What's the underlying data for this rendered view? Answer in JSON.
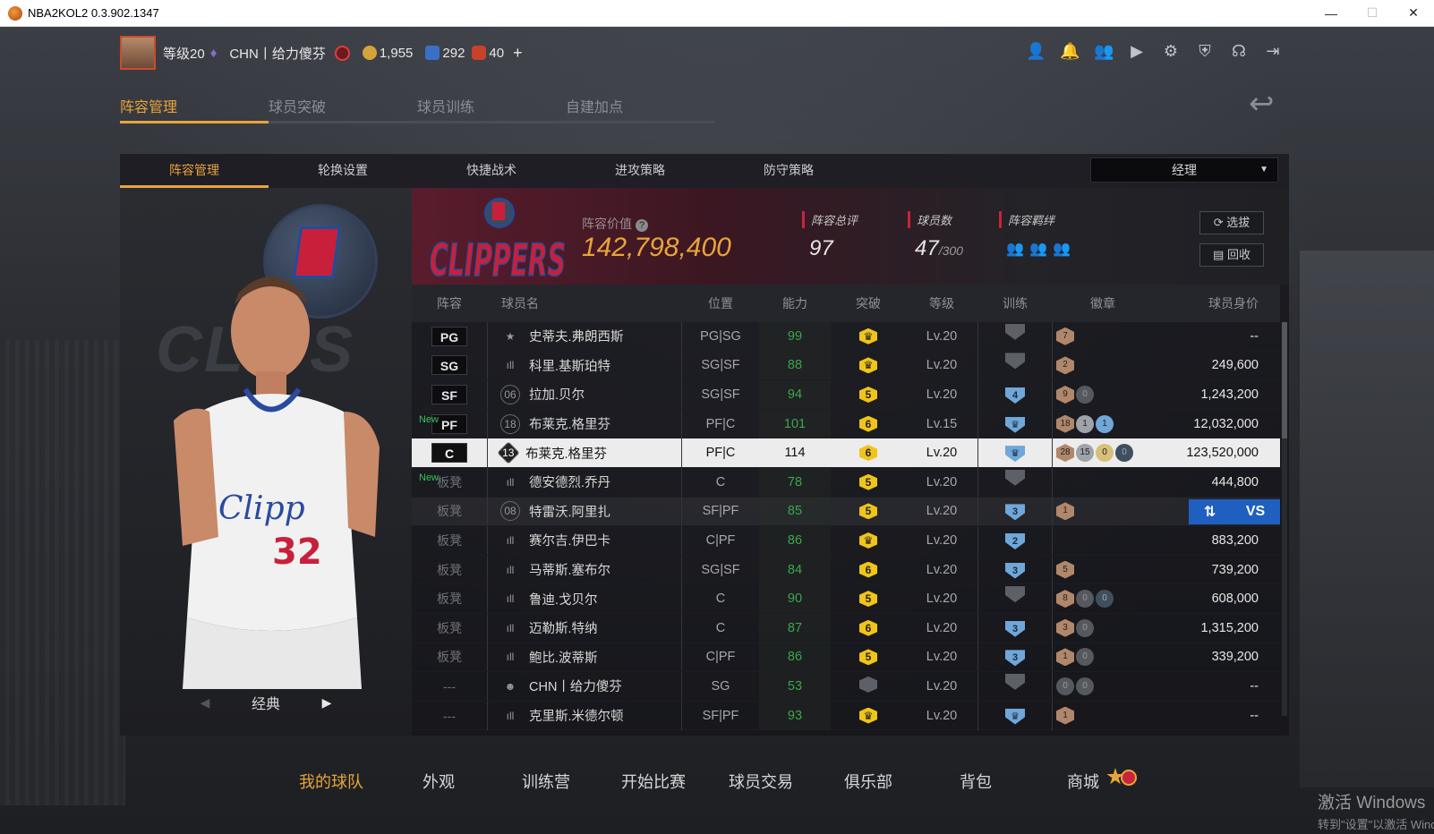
{
  "window": {
    "title": "NBA2KOL2 0.3.902.1347",
    "min": "—",
    "max": "☐",
    "close": "✕"
  },
  "status": {
    "level": "等级20",
    "player": "CHN丨给力傻芬",
    "gold": "1,955",
    "points": "292",
    "tickets": "40",
    "add": "+"
  },
  "toolbar_icons": [
    "user-icon",
    "bell-icon",
    "friends-icon",
    "video-icon",
    "gear-icon",
    "shield-gear-icon",
    "headset-icon",
    "logout-icon"
  ],
  "main_tabs": [
    "阵容管理",
    "球员突破",
    "球员训练",
    "自建加点"
  ],
  "sub_tabs": [
    "阵容管理",
    "轮换设置",
    "快捷战术",
    "进攻策略",
    "防守策略"
  ],
  "role_select": {
    "value": "经理"
  },
  "team": {
    "value_label": "阵容价值",
    "value": "142,798,400",
    "logo_text": "CLIPPERS"
  },
  "stats": {
    "rating_label": "阵容总评",
    "rating": "97",
    "count_label": "球员数",
    "count": "47",
    "count_max": "/300",
    "bond_label": "阵容羁绊"
  },
  "buttons": {
    "select": "选拔",
    "recycle": "回收"
  },
  "carousel": {
    "label": "经典"
  },
  "columns": [
    "阵容",
    "球员名",
    "位置",
    "能力",
    "突破",
    "等级",
    "训练",
    "徽章",
    "球员身价"
  ],
  "rows": [
    {
      "pos": "PG",
      "bench": false,
      "new": "",
      "icon": "★",
      "name": "史蒂夫.弗朗西斯",
      "p": "PG|SG",
      "ab": "99",
      "br": "♛",
      "lv": "Lv.20",
      "tr": "",
      "badges": [
        [
          "br",
          "7"
        ]
      ],
      "price": "--"
    },
    {
      "pos": "SG",
      "bench": false,
      "new": "",
      "icon": "ıll",
      "name": "科里.基斯珀特",
      "p": "SG|SF",
      "ab": "88",
      "br": "♛",
      "lv": "Lv.20",
      "tr": "",
      "badges": [
        [
          "br",
          "2"
        ]
      ],
      "price": "249,600"
    },
    {
      "pos": "SF",
      "bench": false,
      "new": "",
      "icon": "06",
      "name": "拉加.贝尔",
      "p": "SG|SF",
      "ab": "94",
      "br": "5",
      "lv": "Lv.20",
      "tr": "4",
      "badges": [
        [
          "br",
          "9"
        ],
        [
          "gr",
          "0"
        ]
      ],
      "price": "1,243,200"
    },
    {
      "pos": "PF",
      "bench": false,
      "new": "New",
      "icon": "18",
      "name": "布莱克.格里芬",
      "p": "PF|C",
      "ab": "101",
      "br": "6",
      "lv": "Lv.15",
      "tr": "♛",
      "badges": [
        [
          "br",
          "18"
        ],
        [
          "sv",
          "1"
        ],
        [
          "hf",
          "1"
        ]
      ],
      "price": "12,032,000"
    },
    {
      "pos": "C",
      "bench": false,
      "new": "",
      "icon": "13",
      "name": "布莱克.格里芬",
      "p": "PF|C",
      "ab": "114",
      "br": "6",
      "lv": "Lv.20",
      "tr": "♛",
      "badges": [
        [
          "br",
          "28"
        ],
        [
          "sv",
          "15"
        ],
        [
          "gd",
          "0"
        ],
        [
          "em",
          "0"
        ]
      ],
      "price": "123,520,000"
    },
    {
      "pos": "板凳",
      "bench": true,
      "new": "New",
      "icon": "ıll",
      "name": "德安德烈.乔丹",
      "p": "C",
      "ab": "78",
      "br": "5",
      "lv": "Lv.20",
      "tr": "",
      "badges": [],
      "price": "444,800"
    },
    {
      "pos": "板凳",
      "bench": true,
      "new": "",
      "icon": "08",
      "name": "特雷沃.阿里扎",
      "p": "SF|PF",
      "ab": "85",
      "br": "5",
      "lv": "Lv.20",
      "tr": "3",
      "badges": [
        [
          "br",
          "1"
        ]
      ],
      "price": ""
    },
    {
      "pos": "板凳",
      "bench": true,
      "new": "",
      "icon": "ıll",
      "name": "赛尔吉.伊巴卡",
      "p": "C|PF",
      "ab": "86",
      "br": "♛",
      "lv": "Lv.20",
      "tr": "2",
      "badges": [],
      "price": "883,200"
    },
    {
      "pos": "板凳",
      "bench": true,
      "new": "",
      "icon": "ıll",
      "name": "马蒂斯.塞布尔",
      "p": "SG|SF",
      "ab": "84",
      "br": "6",
      "lv": "Lv.20",
      "tr": "3",
      "badges": [
        [
          "br",
          "5"
        ]
      ],
      "price": "739,200"
    },
    {
      "pos": "板凳",
      "bench": true,
      "new": "",
      "icon": "ıll",
      "name": "鲁迪.戈贝尔",
      "p": "C",
      "ab": "90",
      "br": "5",
      "lv": "Lv.20",
      "tr": "",
      "badges": [
        [
          "br",
          "8"
        ],
        [
          "gr",
          "0"
        ],
        [
          "em",
          "0"
        ]
      ],
      "price": "608,000"
    },
    {
      "pos": "板凳",
      "bench": true,
      "new": "",
      "icon": "ıll",
      "name": "迈勒斯.特纳",
      "p": "C",
      "ab": "87",
      "br": "6",
      "lv": "Lv.20",
      "tr": "3",
      "badges": [
        [
          "br",
          "3"
        ],
        [
          "gr",
          "0"
        ]
      ],
      "price": "1,315,200"
    },
    {
      "pos": "板凳",
      "bench": true,
      "new": "",
      "icon": "ıll",
      "name": "鲍比.波蒂斯",
      "p": "C|PF",
      "ab": "86",
      "br": "5",
      "lv": "Lv.20",
      "tr": "3",
      "badges": [
        [
          "br",
          "1"
        ],
        [
          "gr",
          "0"
        ]
      ],
      "price": "339,200"
    },
    {
      "pos": "---",
      "bench": true,
      "new": "",
      "icon": "☻",
      "name": "CHN丨给力傻芬",
      "p": "SG",
      "ab": "53",
      "br": "",
      "lv": "Lv.20",
      "tr": "",
      "badges": [
        [
          "gr",
          "0"
        ],
        [
          "gr",
          "0"
        ]
      ],
      "price": "--"
    },
    {
      "pos": "---",
      "bench": true,
      "new": "",
      "icon": "ıll",
      "name": "克里斯.米德尔顿",
      "p": "SF|PF",
      "ab": "93",
      "br": "♛",
      "lv": "Lv.20",
      "tr": "♛",
      "badges": [
        [
          "br",
          "1"
        ]
      ],
      "price": "--"
    }
  ],
  "vs_button": {
    "label": "VS",
    "swap": "⇅"
  },
  "bottom_nav": [
    "我的球队",
    "外观",
    "训练营",
    "开始比赛",
    "球员交易",
    "俱乐部",
    "背包",
    "商城"
  ],
  "watermark": {
    "line1": "激活 Windows",
    "line2": "转到\"设置\"以激活 Windows"
  }
}
